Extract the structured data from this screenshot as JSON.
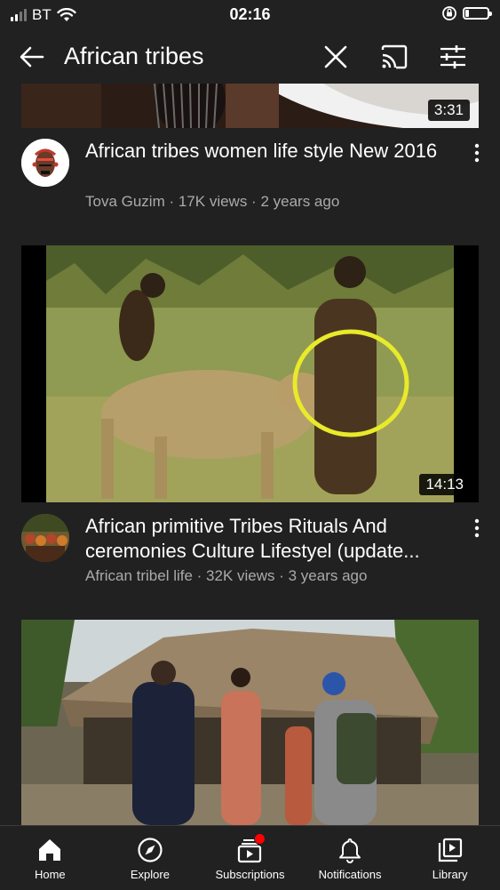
{
  "status_bar": {
    "carrier": "BT",
    "time": "02:16",
    "battery_level": 0.15
  },
  "search": {
    "query": "African tribes"
  },
  "colors": {
    "background": "#212121",
    "meta_text": "#aaaaaa",
    "notification_dot": "#ff0000"
  },
  "results": [
    {
      "duration": "3:31",
      "title": "African tribes women life style   New 2016",
      "meta": "Tova Guzim · 17K views · 2 years ago"
    },
    {
      "duration": "14:13",
      "title": "African primitive Tribes Rituals And ceremonies Culture Lifestyel (update...",
      "meta": "African tribel life · 32K views · 3 years ago"
    },
    {
      "duration": "",
      "title": "",
      "meta": ""
    }
  ],
  "bottom_nav": [
    {
      "label": "Home",
      "icon": "home-icon"
    },
    {
      "label": "Explore",
      "icon": "compass-icon"
    },
    {
      "label": "Subscriptions",
      "icon": "subscriptions-icon"
    },
    {
      "label": "Notifications",
      "icon": "bell-icon"
    },
    {
      "label": "Library",
      "icon": "library-icon"
    }
  ]
}
